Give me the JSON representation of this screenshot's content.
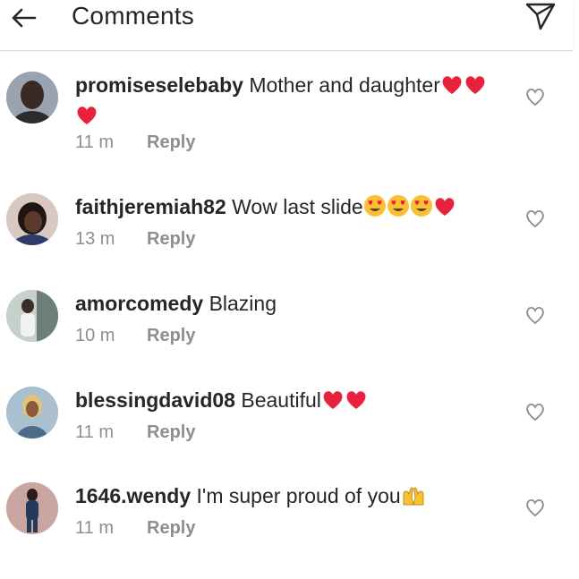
{
  "header": {
    "title": "Comments"
  },
  "comments": [
    {
      "username": "promiseselebaby",
      "text": "Mother and daughter",
      "emojis_line1": [
        "heart",
        "heart"
      ],
      "emojis_line2": [
        "heart"
      ],
      "time": "11 m",
      "reply": "Reply"
    },
    {
      "username": "faithjeremiah82",
      "text": "Wow last slide",
      "emojis_line1": [
        "heart-eyes",
        "heart-eyes",
        "heart-eyes",
        "heart"
      ],
      "time": "13 m",
      "reply": "Reply"
    },
    {
      "username": "amorcomedy",
      "text": "Blazing",
      "emojis_line1": [],
      "time": "10 m",
      "reply": "Reply"
    },
    {
      "username": "blessingdavid08",
      "text": "Beautiful",
      "emojis_line1": [
        "heart",
        "heart"
      ],
      "time": "11 m",
      "reply": "Reply"
    },
    {
      "username": "1646.wendy",
      "text": "I'm super proud of you",
      "emojis_line1": [
        "raised-hands"
      ],
      "time": "11 m",
      "reply": "Reply"
    }
  ],
  "colors": {
    "heart": "#e8213c",
    "muted": "#8e8e8e",
    "text": "#262626",
    "emoji_face": "#f7c133"
  }
}
